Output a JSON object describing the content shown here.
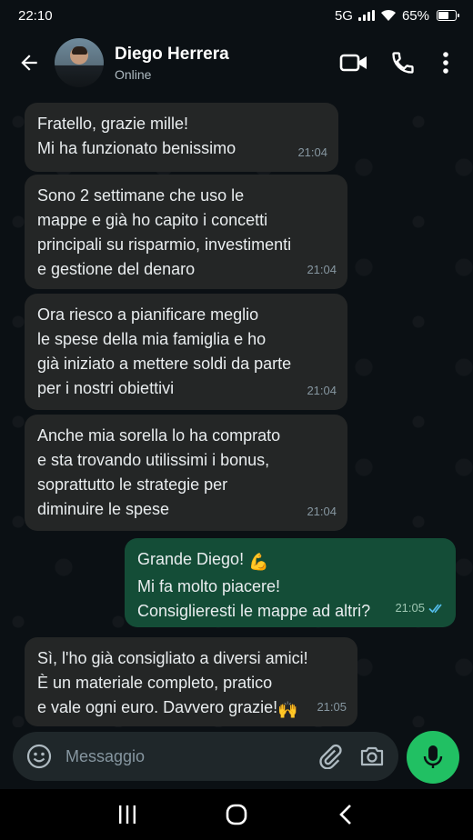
{
  "status": {
    "time": "22:10",
    "network": "5G",
    "battery": "65%",
    "battery_level": 0.65
  },
  "header": {
    "name": "Diego Herrera",
    "status": "Online"
  },
  "messages": [
    {
      "direction": "in",
      "text": "Fratello, grazie mille!\nMi ha funzionato benissimo",
      "time": "21:04"
    },
    {
      "direction": "in",
      "text": "Sono 2 settimane che uso le\nmappe e già ho capito i concetti\nprincipali su risparmio, investimenti\ne gestione del denaro",
      "time": "21:04"
    },
    {
      "direction": "in",
      "text": "Ora riesco a pianificare meglio\nle spese della mia famiglia e ho\ngià iniziato a mettere  soldi da parte\nper i nostri obiettivi",
      "time": "21:04"
    },
    {
      "direction": "in",
      "text": "Anche mia sorella lo ha comprato\ne sta trovando utilissimi i bonus,\nsoprattutto le strategie per\ndiminuire le spese",
      "time": "21:04"
    },
    {
      "direction": "out",
      "text_line1": "Grande Diego!",
      "emoji1": "💪",
      "text_rest": "Mi fa molto piacere!\nConsiglieresti le mappe ad altri?",
      "time": "21:05",
      "read_icon": "double-check-icon"
    },
    {
      "direction": "in",
      "text_main": "Sì, l'ho già consigliato a diversi amici!\nÈ un materiale completo, pratico\ne vale ogni euro. Davvero grazie!",
      "emoji": "🙌",
      "time": "21:05"
    }
  ],
  "composer": {
    "placeholder": "Messaggio"
  },
  "colors": {
    "incoming": "#242626",
    "outgoing": "#144d37",
    "accent": "#21c063",
    "background": "#0b1014"
  }
}
